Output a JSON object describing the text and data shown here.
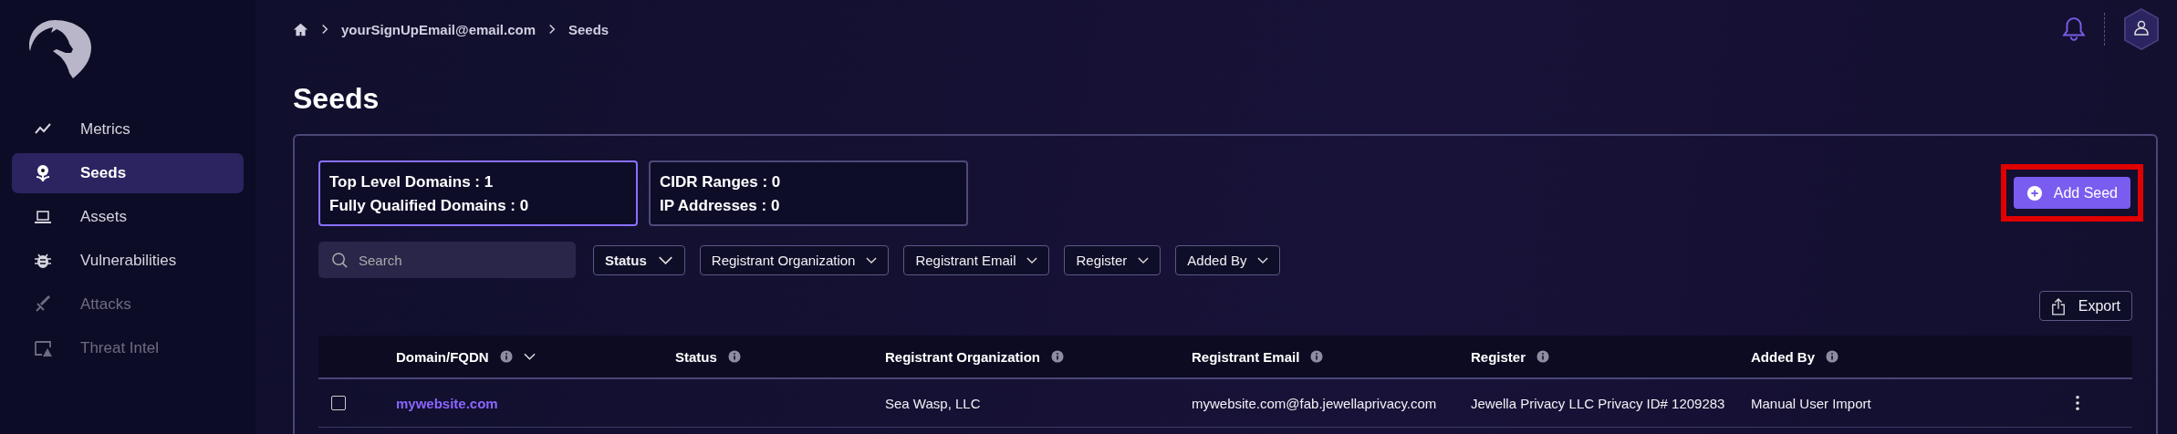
{
  "sidebar": {
    "items": [
      {
        "label": "Metrics",
        "selected": false,
        "disabled": false
      },
      {
        "label": "Seeds",
        "selected": true,
        "disabled": false
      },
      {
        "label": "Assets",
        "selected": false,
        "disabled": false
      },
      {
        "label": "Vulnerabilities",
        "selected": false,
        "disabled": false
      },
      {
        "label": "Attacks",
        "selected": false,
        "disabled": true
      },
      {
        "label": "Threat Intel",
        "selected": false,
        "disabled": true
      }
    ]
  },
  "breadcrumb": [
    "yourSignUpEmail@email.com",
    "Seeds"
  ],
  "page_title": "Seeds",
  "stat_cards": [
    {
      "lines": [
        "Top Level Domains : 1",
        "Fully Qualified Domains : 0"
      ],
      "selected": true
    },
    {
      "lines": [
        "CIDR Ranges : 0",
        "IP Addresses : 0"
      ],
      "selected": false
    }
  ],
  "add_button": {
    "label": "Add Seed",
    "highlighted": true
  },
  "search": {
    "placeholder": "Search"
  },
  "filters": [
    {
      "label": "Status",
      "selected": true
    },
    {
      "label": "Registrant Organization",
      "selected": false
    },
    {
      "label": "Registrant Email",
      "selected": false
    },
    {
      "label": "Register",
      "selected": false
    },
    {
      "label": "Added By",
      "selected": false
    }
  ],
  "export_button": "Export",
  "table": {
    "columns": [
      {
        "label": "Domain/FQDN",
        "sortable": true
      },
      {
        "label": "Status",
        "sortable": false
      },
      {
        "label": "Registrant Organization",
        "sortable": false
      },
      {
        "label": "Registrant Email",
        "sortable": false
      },
      {
        "label": "Register",
        "sortable": false
      },
      {
        "label": "Added By",
        "sortable": false
      }
    ],
    "rows": [
      {
        "checked": false,
        "cells": [
          "mywebsite.com",
          "",
          "Sea Wasp, LLC",
          "mywebsite.com@fab.jewellaprivacy.com",
          "Jewella Privacy LLC Privacy ID# 1209283",
          "Manual User Import"
        ]
      }
    ]
  }
}
